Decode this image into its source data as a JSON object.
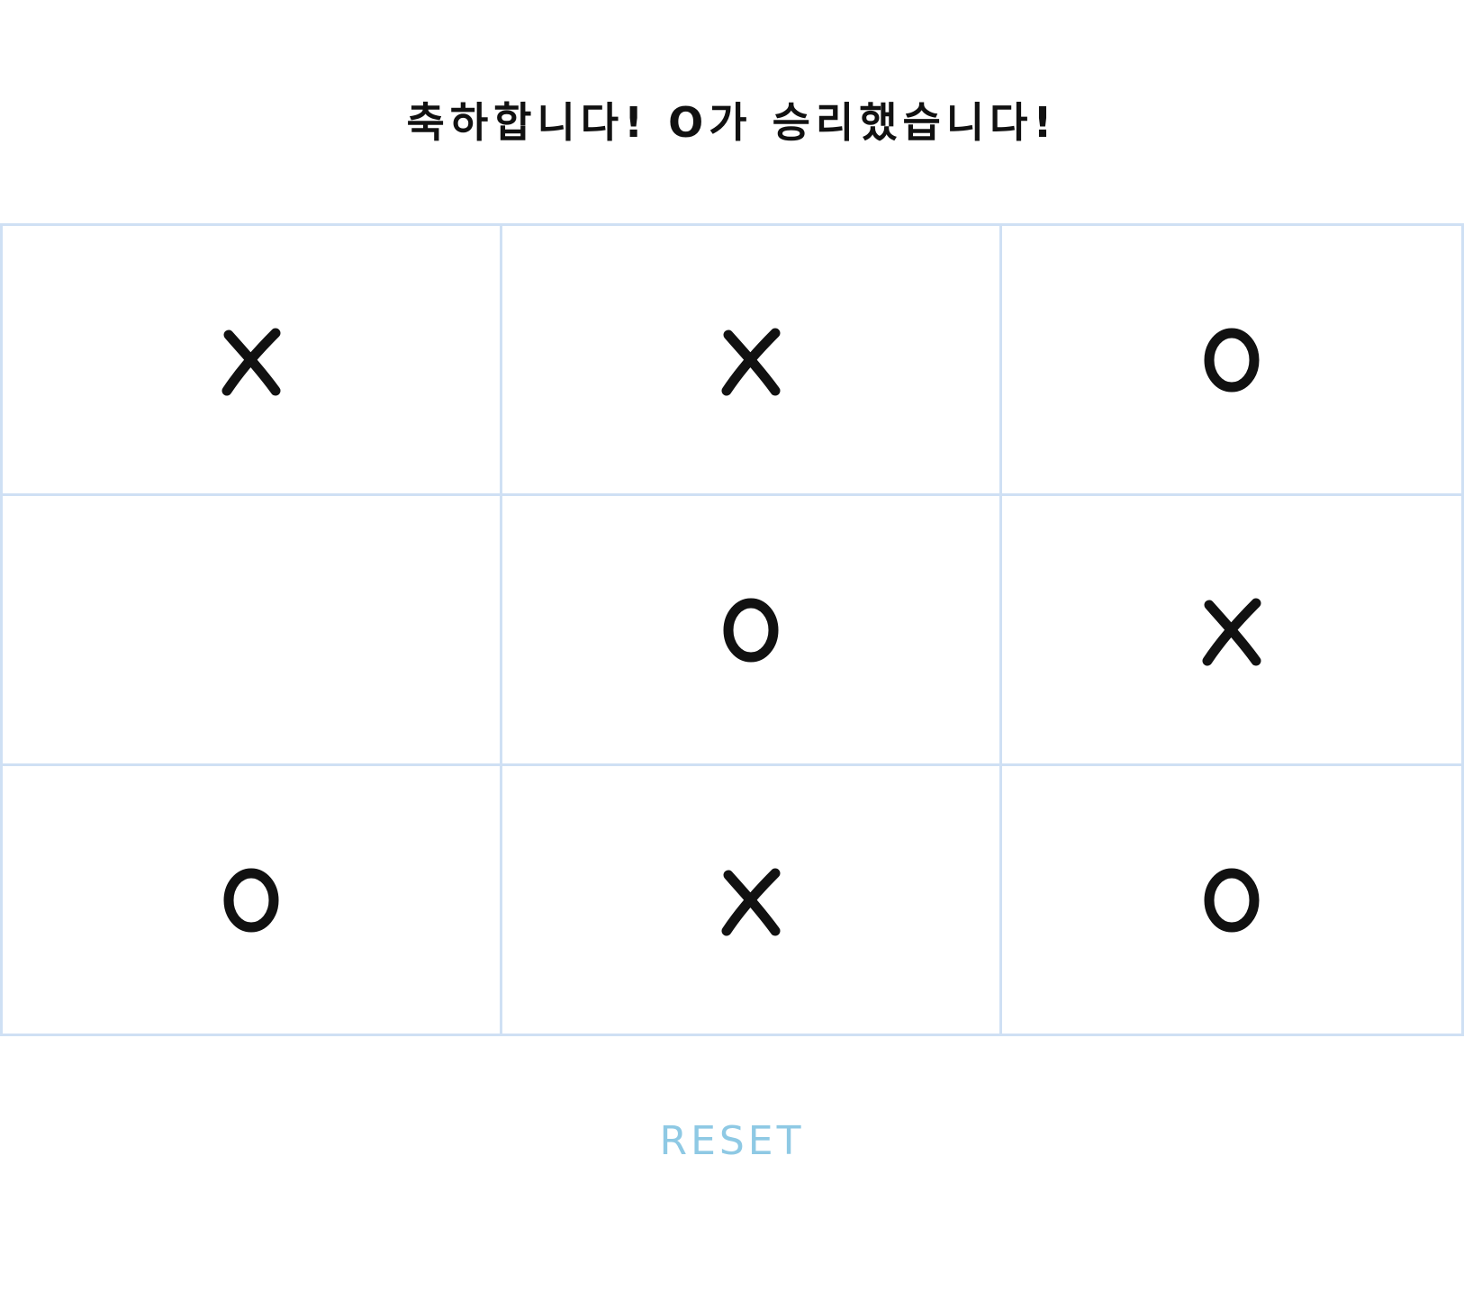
{
  "status": {
    "message": "축하합니다! O가 승리했습니다!"
  },
  "board": {
    "cells": [
      "X",
      "X",
      "O",
      "",
      "O",
      "X",
      "O",
      "X",
      "O"
    ]
  },
  "controls": {
    "reset_label": "RESET"
  },
  "colors": {
    "grid_line": "#cfe0f4",
    "mark": "#111111",
    "reset_text": "#8ec9e4",
    "background": "#ffffff"
  }
}
